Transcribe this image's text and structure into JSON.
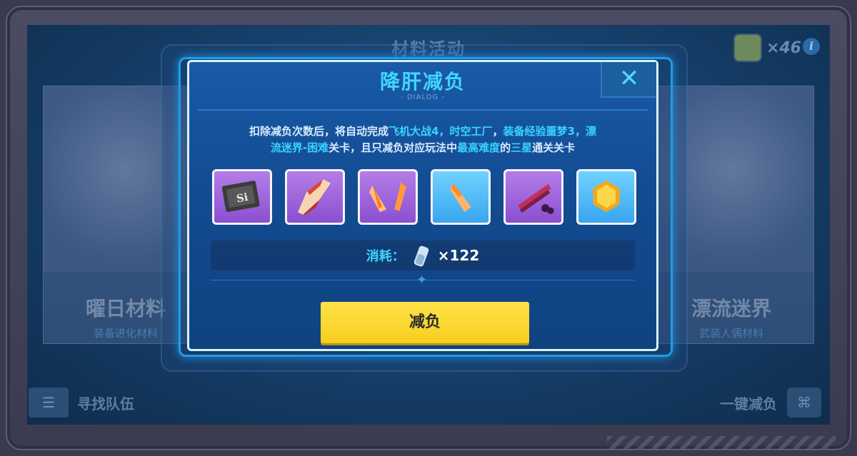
{
  "background": {
    "title": "材料活动",
    "currency_count": "×46",
    "info_icon": "i",
    "cards": [
      {
        "name": "曜日材料",
        "sub": "装备进化材料"
      },
      {
        "name": "漂流迷界",
        "sub": "武装人偶材料"
      }
    ],
    "bottom_left_label": "寻找队伍",
    "bottom_right_label": "一键减负"
  },
  "dialog": {
    "title": "降肝减负",
    "subtitle": "- DIALOG -",
    "close_icon": "close-icon",
    "description": {
      "line1_a": "扣除减负次数后，将自动完成",
      "line1_b": "飞机大战4，时空工厂",
      "line1_c": "，",
      "line1_d": "装备经验噩梦3，漂",
      "line2_a": "流迷界-困难",
      "line2_b": "关卡，且只减负对应玩法中",
      "line2_c": "最高难度",
      "line2_d": "的",
      "line2_e": "三星",
      "line2_f": "通关关卡"
    },
    "items": [
      {
        "name": "si-chip-item",
        "rarity": "purple"
      },
      {
        "name": "red-shard-item",
        "rarity": "purple"
      },
      {
        "name": "orange-crystals-item",
        "rarity": "purple"
      },
      {
        "name": "orange-crystal-item",
        "rarity": "blue"
      },
      {
        "name": "red-blades-item",
        "rarity": "purple"
      },
      {
        "name": "gold-coin-item",
        "rarity": "blue"
      }
    ],
    "cost_label": "消耗：",
    "cost_icon": "stamina-vial-icon",
    "cost_value": "×122",
    "action_label": "减负"
  }
}
